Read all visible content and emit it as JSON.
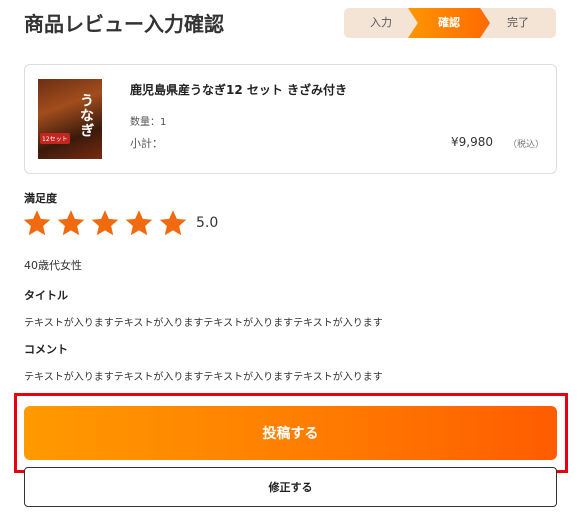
{
  "page": {
    "title": "商品レビュー入力確認"
  },
  "steps": [
    {
      "label": "入力"
    },
    {
      "label": "確認"
    },
    {
      "label": "完了"
    }
  ],
  "product": {
    "name": "鹿児島県産うなぎ12 セット きざみ付き",
    "quantity": "数量：1",
    "subtotal_label": "小計：",
    "price": "¥9,980",
    "tax_note": "（税込）",
    "image_tag": "12セット",
    "image_kanji": "うなぎ"
  },
  "review": {
    "satisfaction_label": "満足度",
    "rating": 5,
    "rating_text": "5.0",
    "age_gender": "40歳代女性",
    "title_label": "タイトル",
    "title_text": "テキストが入りますテキストが入りますテキストが入りますテキストが入ります",
    "comment_label": "コメント",
    "comment_text": "テキストが入りますテキストが入りますテキストが入りますテキストが入ります"
  },
  "actions": {
    "submit_label": "投稿する",
    "edit_label": "修正する"
  },
  "colors": {
    "accent": "#ff7c00",
    "star": "#f26a10",
    "highlight": "#e8000d",
    "step_inactive": "#f3e4d6"
  }
}
